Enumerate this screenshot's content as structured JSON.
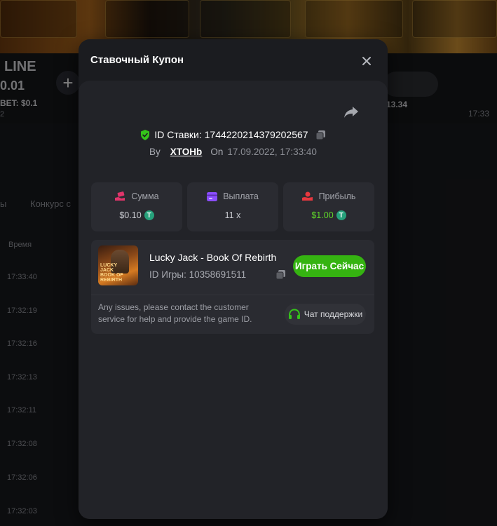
{
  "background": {
    "game_label": "LINE",
    "bet_amount": "0.01",
    "bet_label": "BET: $0.1",
    "bet_sub": "2",
    "right_value": "13.34",
    "right_time": "17:33",
    "tabs": [
      "ы",
      "Конкурс с"
    ],
    "time_header": "Время",
    "times": [
      "17:33:40",
      "17:32:19",
      "17:32:16",
      "17:32:13",
      "17:32:11",
      "17:32:08",
      "17:32:06",
      "17:32:03"
    ]
  },
  "modal": {
    "title": "Ставочный Купон",
    "bet_id_label": "ID Ставки: 1744220214379202567",
    "by_label": "By",
    "user": "XTOHb",
    "on_label": "On",
    "date": "17.09.2022, 17:33:40",
    "stats": [
      {
        "label": "Сумма",
        "value": "$0.10",
        "coin": true,
        "value_green": false
      },
      {
        "label": "Выплата",
        "value": "11 x",
        "coin": false,
        "value_green": false
      },
      {
        "label": "Прибыль",
        "value": "$1.00",
        "coin": true,
        "value_green": true
      }
    ],
    "game": {
      "name": "Lucky Jack - Book Of Rebirth",
      "id_label": "ID Игры: 10358691511",
      "thumb_text": "LUCKY JACK BOOK OF REBIRTH",
      "play_label": "Играть Сейчас"
    },
    "issue_text": "Any issues, please contact the customer service for help and provide the game ID.",
    "support_label": "Чат поддержки"
  },
  "colors": {
    "accent_green": "#35b311",
    "profit_green": "#5fd42a",
    "tether": "#26a17b",
    "panel": "#222328"
  }
}
